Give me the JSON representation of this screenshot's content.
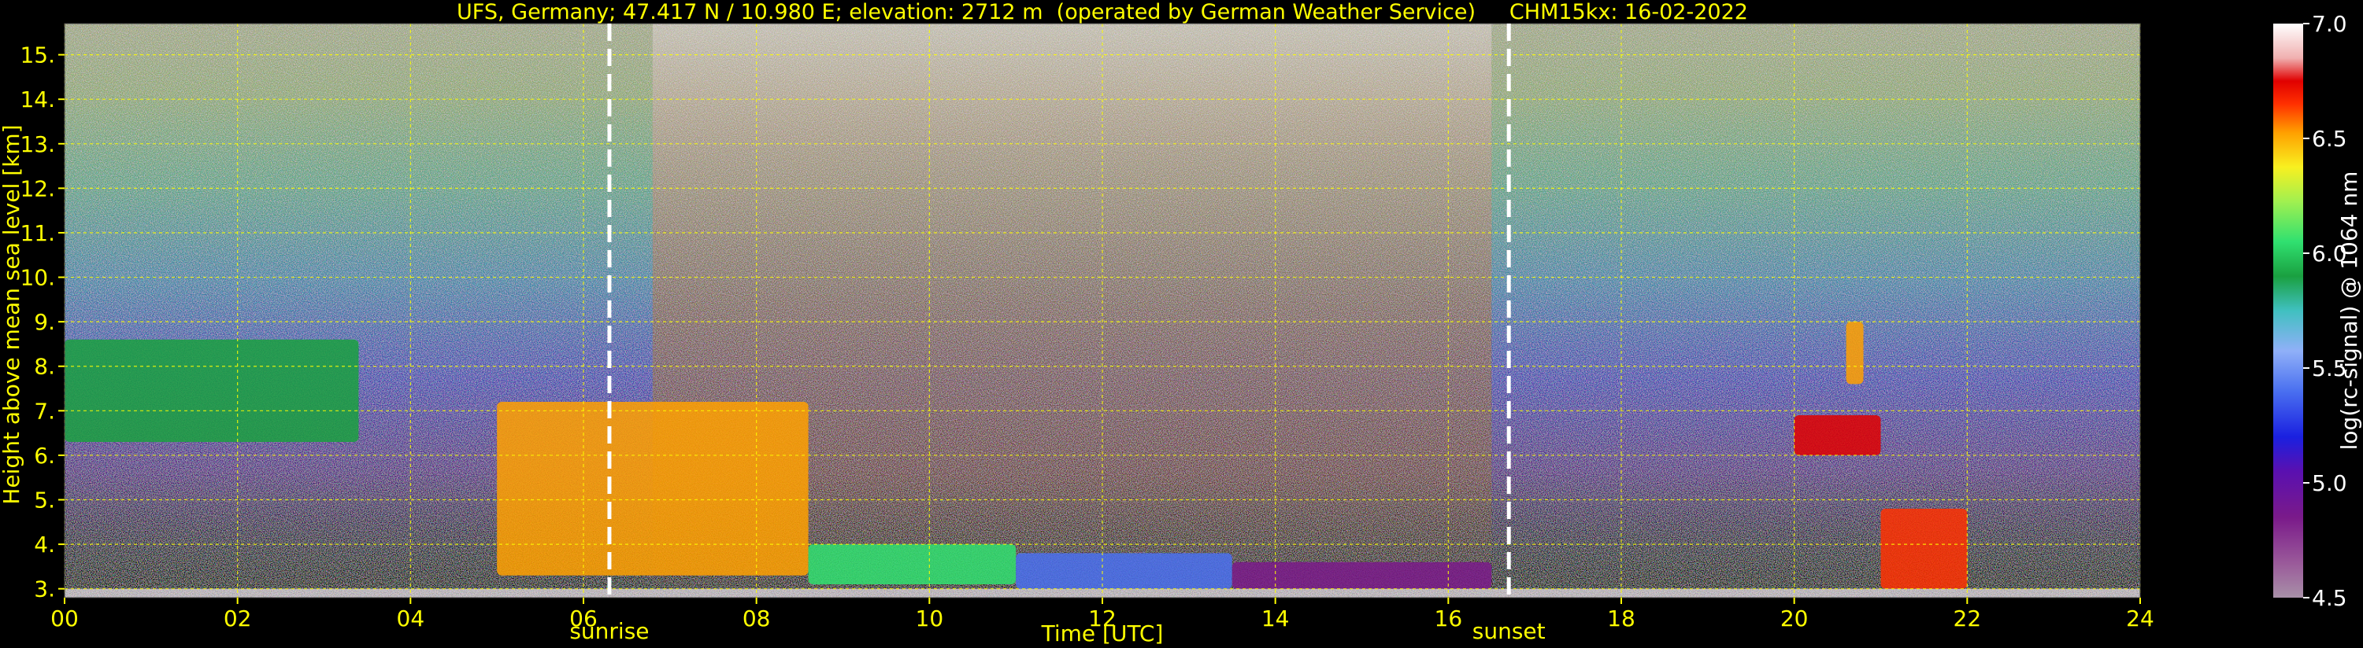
{
  "chart_data": {
    "type": "heatmap",
    "title": "UFS, Germany; 47.417 N / 10.980 E; elevation: 2712 m  (operated by German Weather Service)     CHM15kx: 16-02-2022",
    "xlabel": "Time [UTC]",
    "ylabel": "Height above mean sea level [km]",
    "colorbar_label": "log(rc-signal) @ 1064 nm",
    "xlim": [
      0,
      24
    ],
    "ylim": [
      2.8,
      15.7
    ],
    "x_tick_labels": [
      "00",
      "02",
      "04",
      "06",
      "08",
      "10",
      "12",
      "14",
      "16",
      "18",
      "20",
      "22",
      "24"
    ],
    "y_tick_labels": [
      "3.",
      "4.",
      "5.",
      "6.",
      "7.",
      "8.",
      "9.",
      "10.",
      "11.",
      "12.",
      "13.",
      "14.",
      "15."
    ],
    "colorbar_range": [
      4.5,
      7.0
    ],
    "colorbar_tick_labels": [
      "4.5",
      "5.0",
      "5.5",
      "6.0",
      "6.5",
      "7.0"
    ],
    "grid": true,
    "annotations": [
      {
        "text": "sunrise",
        "x": 6.3
      },
      {
        "text": "sunset",
        "x": 16.7
      }
    ],
    "colors": {
      "background": "#000000",
      "text": "#ffff00",
      "grid": "#ffff00",
      "marker_lines": "#ffffff",
      "colorbar_text": "#ffffff"
    },
    "features": [
      {
        "name": "cirrus-layer",
        "t0": 0.0,
        "t1": 3.4,
        "h0": 6.3,
        "h1": 8.6,
        "level": 6.0
      },
      {
        "name": "cloud-band-descending",
        "t0": 5.0,
        "t1": 8.6,
        "h0": 3.3,
        "h1": 7.2,
        "level": 6.6
      },
      {
        "name": "boundary-layer-green",
        "t0": 8.6,
        "t1": 11.0,
        "h0": 3.1,
        "h1": 4.0,
        "level": 6.1
      },
      {
        "name": "boundary-layer-blue",
        "t0": 11.0,
        "t1": 13.5,
        "h0": 3.0,
        "h1": 3.8,
        "level": 5.5
      },
      {
        "name": "boundary-layer-purple",
        "t0": 13.5,
        "t1": 16.5,
        "h0": 3.0,
        "h1": 3.6,
        "level": 5.0
      },
      {
        "name": "evening-cloud-upper",
        "t0": 20.6,
        "t1": 20.8,
        "h0": 7.6,
        "h1": 9.0,
        "level": 6.6
      },
      {
        "name": "evening-cloud-lower",
        "t0": 20.0,
        "t1": 21.0,
        "h0": 6.0,
        "h1": 6.9,
        "level": 6.8
      },
      {
        "name": "evening-descent",
        "t0": 21.0,
        "t1": 22.0,
        "h0": 3.0,
        "h1": 4.8,
        "level": 6.7
      }
    ]
  }
}
